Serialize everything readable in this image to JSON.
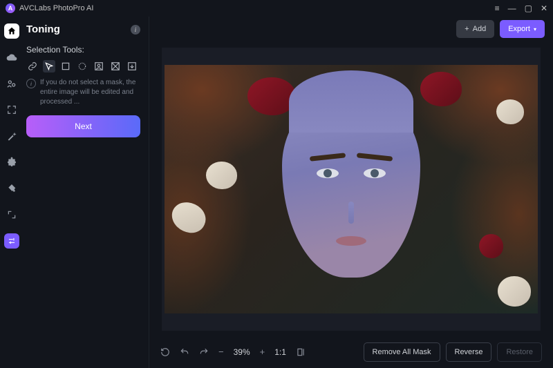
{
  "app": {
    "name": "AVCLabs PhotoPro AI"
  },
  "panel": {
    "title": "Toning"
  },
  "selection": {
    "label": "Selection Tools:",
    "hint": "If you do not select a mask, the entire image will be edited and processed ..."
  },
  "buttons": {
    "next": "Next",
    "add": "Add",
    "export": "Export",
    "removeAllMask": "Remove All Mask",
    "reverse": "Reverse",
    "restore": "Restore"
  },
  "zoom": {
    "value": "39%",
    "ratio": "1:1"
  }
}
